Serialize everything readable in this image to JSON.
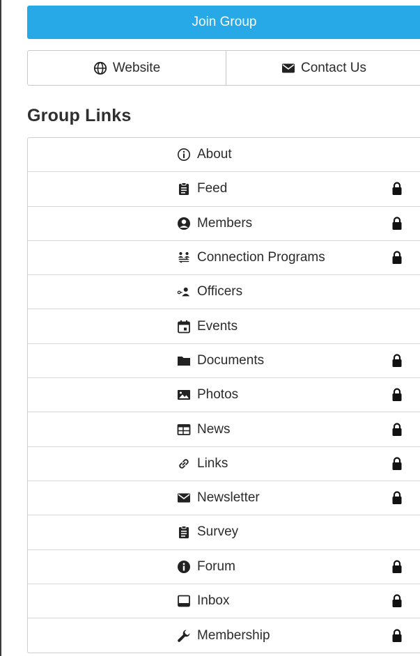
{
  "join_button": {
    "label": "Join Group",
    "color": "#26a9e6"
  },
  "actions": {
    "website": {
      "label": "Website",
      "icon": "globe-icon"
    },
    "contact": {
      "label": "Contact Us",
      "icon": "envelope-icon"
    }
  },
  "group_links": {
    "heading": "Group Links",
    "items": [
      {
        "label": "About",
        "icon": "info-circle-outline-icon",
        "locked": false
      },
      {
        "label": "Feed",
        "icon": "clipboard-icon",
        "locked": true
      },
      {
        "label": "Members",
        "icon": "user-circle-icon",
        "locked": true
      },
      {
        "label": "Connection Programs",
        "icon": "people-exchange-icon",
        "locked": true
      },
      {
        "label": "Officers",
        "icon": "officer-icon",
        "locked": false
      },
      {
        "label": "Events",
        "icon": "calendar-icon",
        "locked": false
      },
      {
        "label": "Documents",
        "icon": "folder-icon",
        "locked": true
      },
      {
        "label": "Photos",
        "icon": "photo-icon",
        "locked": true
      },
      {
        "label": "News",
        "icon": "newspaper-icon",
        "locked": true
      },
      {
        "label": "Links",
        "icon": "link-icon",
        "locked": true
      },
      {
        "label": "Newsletter",
        "icon": "envelope-icon",
        "locked": true
      },
      {
        "label": "Survey",
        "icon": "clipboard-icon",
        "locked": false
      },
      {
        "label": "Forum",
        "icon": "info-circle-solid-icon",
        "locked": true
      },
      {
        "label": "Inbox",
        "icon": "inbox-icon",
        "locked": true
      },
      {
        "label": "Membership",
        "icon": "wrench-icon",
        "locked": true
      }
    ]
  }
}
